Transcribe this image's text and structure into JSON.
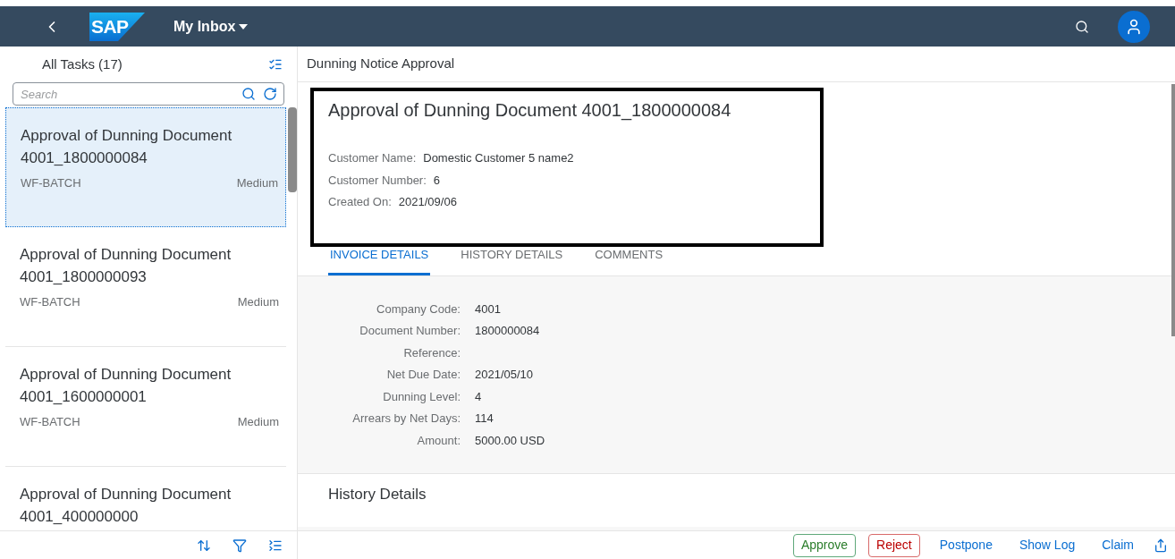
{
  "shell": {
    "logo": "SAP",
    "title": "My Inbox"
  },
  "task_list": {
    "title": "All Tasks (17)",
    "search": {
      "placeholder": "Search"
    },
    "items": [
      {
        "title": "Approval of Dunning Document 4001_1800000084",
        "creator": "WF-BATCH",
        "priority": "Medium",
        "selected": true
      },
      {
        "title": "Approval of Dunning Document 4001_1800000093",
        "creator": "WF-BATCH",
        "priority": "Medium",
        "selected": false
      },
      {
        "title": "Approval of Dunning Document 4001_1600000001",
        "creator": "WF-BATCH",
        "priority": "Medium",
        "selected": false
      },
      {
        "title": "Approval of Dunning Document 4001_400000000",
        "selected": false
      }
    ]
  },
  "detail": {
    "header": "Dunning Notice Approval",
    "title": "Approval of Dunning Document 4001_1800000084",
    "attributes": [
      {
        "label": "Customer Name:",
        "value": "Domestic Customer 5 name2"
      },
      {
        "label": "Customer Number:",
        "value": "6"
      },
      {
        "label": "Created On:",
        "value": "2021/09/06"
      }
    ],
    "tabs": [
      {
        "label": "INVOICE DETAILS",
        "selected": true
      },
      {
        "label": "HISTORY DETAILS",
        "selected": false
      },
      {
        "label": "COMMENTS",
        "selected": false
      }
    ],
    "invoice_fields": [
      {
        "label": "Company Code:",
        "value": "4001"
      },
      {
        "label": "Document Number:",
        "value": "1800000084"
      },
      {
        "label": "Reference:"
      },
      {
        "label": "Net Due Date:",
        "value": "2021/05/10"
      },
      {
        "label": "Dunning Level:",
        "value": "4"
      },
      {
        "label": "Arrears by Net Days:",
        "value": "114"
      },
      {
        "label": "Amount:",
        "value": "5000.00 USD"
      }
    ],
    "section_title": "History Details"
  },
  "footer": {
    "actions": [
      {
        "label": "Approve",
        "kind": "accept"
      },
      {
        "label": "Reject",
        "kind": "reject"
      },
      {
        "label": "Postpone",
        "kind": "plain"
      },
      {
        "label": "Show Log",
        "kind": "plain"
      },
      {
        "label": "Claim",
        "kind": "plain"
      }
    ]
  }
}
